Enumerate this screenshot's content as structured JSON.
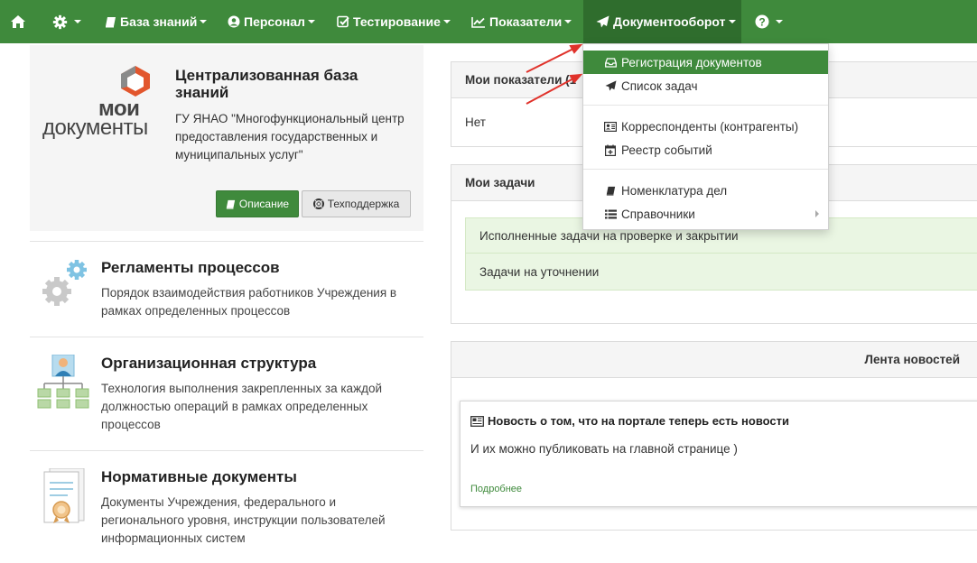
{
  "navbar": {
    "home_icon": "home-icon",
    "settings_icon": "gear-icon",
    "items": [
      {
        "label": "База знаний",
        "icon": "book-icon"
      },
      {
        "label": "Персонал",
        "icon": "user-circle-icon"
      },
      {
        "label": "Тестирование",
        "icon": "check-square-icon"
      },
      {
        "label": "Показатели",
        "icon": "line-chart-icon"
      },
      {
        "label": "Документооборот",
        "icon": "paper-plane-icon"
      }
    ],
    "help_icon": "question-circle-icon",
    "accent_color": "#3f8a3c",
    "active_color": "#2f6d2d"
  },
  "hero": {
    "logo": {
      "line1": "мои",
      "line2": "документы"
    },
    "title": "Централизованная база знаний",
    "org": "ГУ ЯНАО \"Многофункциональный центр предоставления государственных и муниципальных услуг\"",
    "description_button": "Описание",
    "support_button": "Техподдержка"
  },
  "sections": [
    {
      "title": "Регламенты процессов",
      "desc": "Порядок взаимодействия работников Учреждения в рамках определенных процессов",
      "icon": "gears-icon"
    },
    {
      "title": "Организационная структура",
      "desc": "Технология выполнения закрепленных за каждой должностью операций в рамках определенных процессов",
      "icon": "org-chart-icon"
    },
    {
      "title": "Нормативные документы",
      "desc": "Документы Учреждения, федерального и регионального уровня, инструкции пользователей информационных систем",
      "icon": "certificate-icon"
    }
  ],
  "panels": {
    "indicators": {
      "title": "Мои показатели (1",
      "value": "Нет"
    },
    "tasks": {
      "title": "Мои задачи",
      "items": [
        "Исполненные задачи на проверке и закрытии",
        "Задачи на уточнении"
      ]
    },
    "news": {
      "title": "Лента новостей",
      "item_title": "Новость о том, что на портале теперь есть новости",
      "item_body": "И их можно публиковать на главной странице )",
      "more": "Подробнее"
    }
  },
  "dropdown": {
    "group1": [
      {
        "label": "Регистрация документов",
        "icon": "inbox-icon",
        "active": true
      },
      {
        "label": "Список задач",
        "icon": "paper-plane-icon"
      }
    ],
    "group2": [
      {
        "label": "Корреспонденты (контрагенты)",
        "icon": "address-card-icon"
      },
      {
        "label": "Реестр событий",
        "icon": "calendar-plus-icon"
      }
    ],
    "group3": [
      {
        "label": "Номенклатура дел",
        "icon": "book-icon"
      },
      {
        "label": "Справочники",
        "icon": "list-icon"
      }
    ]
  },
  "annotations": {
    "arrow_color": "#e0322b"
  }
}
